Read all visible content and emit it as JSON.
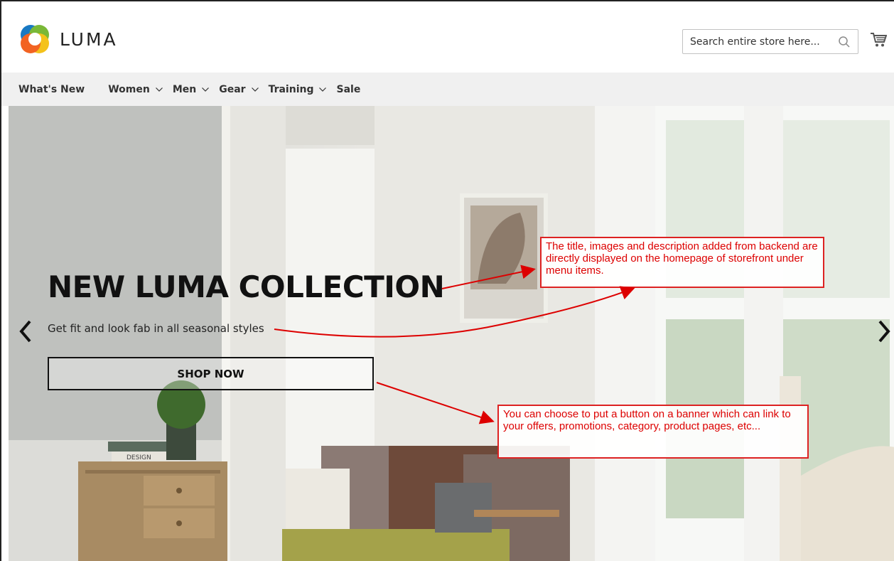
{
  "brand": {
    "name": "LUMA"
  },
  "search": {
    "placeholder": "Search entire store here..."
  },
  "nav": {
    "items": [
      {
        "label": "What's New",
        "has_dropdown": false
      },
      {
        "label": "Women",
        "has_dropdown": true
      },
      {
        "label": "Men",
        "has_dropdown": true
      },
      {
        "label": "Gear",
        "has_dropdown": true
      },
      {
        "label": "Training",
        "has_dropdown": true
      },
      {
        "label": "Sale",
        "has_dropdown": false
      }
    ]
  },
  "hero": {
    "title": "NEW LUMA COLLECTION",
    "description": "Get fit and look fab in all seasonal styles",
    "button_label": "SHOP NOW"
  },
  "annotations": {
    "note1": "The title,  images and description added from backend are directly displayed on the homepage of storefront under menu items.",
    "note2": "You can choose to put a button on a banner which can link to your offers, promotions, category, product pages, etc...",
    "book_label": "DESIGN"
  },
  "colors": {
    "annotation": "#d00000",
    "nav_bg": "#f0f0f0",
    "logo_orange": "#f26322",
    "logo_blue": "#1979c3",
    "logo_green": "#7ab837",
    "logo_yellow": "#f4c21b"
  }
}
